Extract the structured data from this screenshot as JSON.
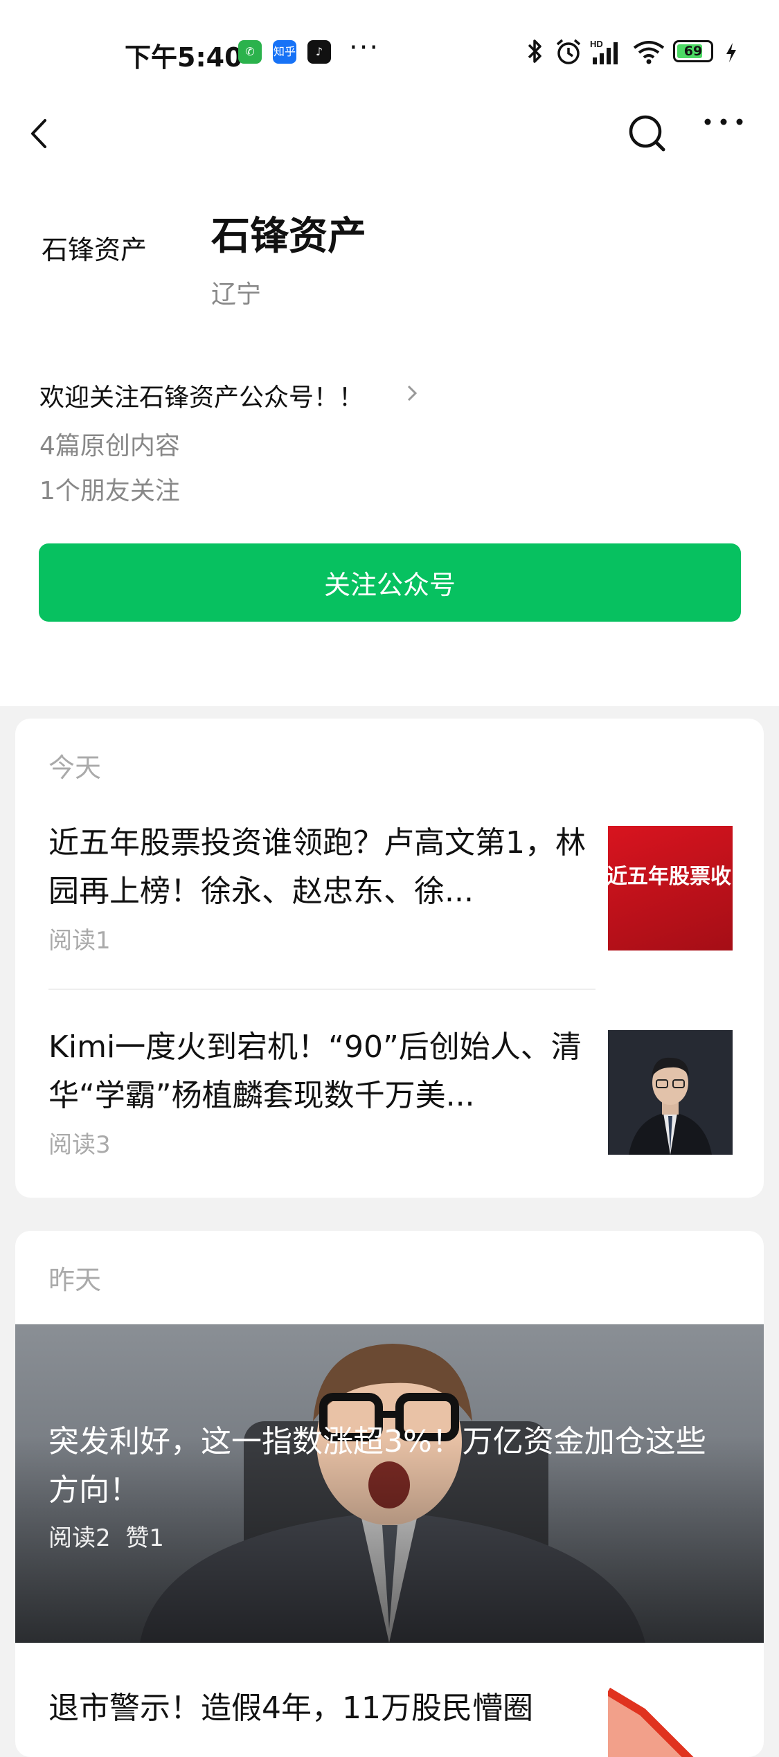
{
  "status_bar": {
    "time": "下午5:40",
    "zhihu_label": "知乎",
    "more_dots": "···",
    "battery_level": "69",
    "hd_label": "HD"
  },
  "account": {
    "logo_text": "石锋资产",
    "name": "石锋资产",
    "region": "辽宁",
    "welcome": "欢迎关注石锋资产公众号！！",
    "original_count": "4篇原创内容",
    "friends_following": "1个朋友关注",
    "follow_button": "关注公众号"
  },
  "today": {
    "label": "今天",
    "articles": [
      {
        "title": "近五年股票投资谁领跑？卢高文第1，林园再上榜！徐永、赵忠东、徐...",
        "meta": "阅读1",
        "thumb_text": "近五年股票收"
      },
      {
        "title": "Kimi一度火到宕机！“90”后创始人、清华“学霸”杨植麟套现数千万美...",
        "meta": "阅读3"
      }
    ]
  },
  "yesterday": {
    "label": "昨天",
    "hero": {
      "title": "突发利好，这一指数涨超3%！万亿资金加仓这些方向！",
      "meta": "阅读2  赞1"
    },
    "articles": [
      {
        "title": "退市警示！造假4年，11万股民懵圈"
      }
    ]
  },
  "colors": {
    "accent_green": "#07c160",
    "thumb_red": "#c8101d",
    "battery_green": "#4cd964"
  }
}
